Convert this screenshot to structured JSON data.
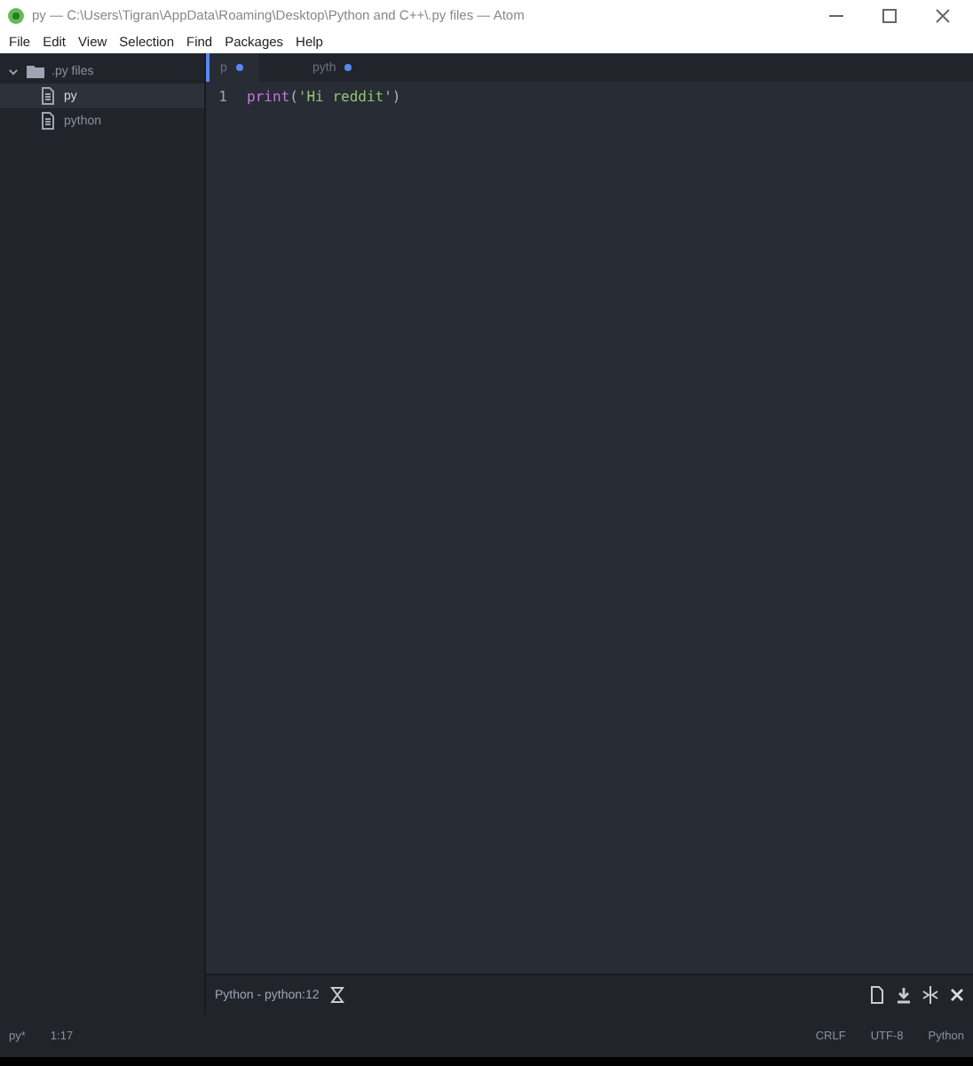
{
  "window": {
    "title": "py — C:\\Users\\Tigran\\AppData\\Roaming\\Desktop\\Python and C++\\.py files — Atom"
  },
  "menu": [
    "File",
    "Edit",
    "View",
    "Selection",
    "Find",
    "Packages",
    "Help"
  ],
  "tree": {
    "label": ".py files",
    "expanded": true,
    "children": [
      {
        "label": "py",
        "selected": true
      },
      {
        "label": "python",
        "selected": false
      }
    ]
  },
  "tabs": [
    {
      "label": "p",
      "selected": true,
      "modified": true
    },
    {
      "label": "pyth",
      "selected": false,
      "modified": true
    }
  ],
  "editor": {
    "lines": [
      {
        "number": "1",
        "keyword": "print",
        "rest": "(",
        "string": "'Hi reddit'",
        "end": ")"
      }
    ]
  },
  "panel": {
    "label": "Python - python:12"
  },
  "status": {
    "file": "py*",
    "cursor": "1:17",
    "right": [
      "CRLF",
      "UTF-8",
      "Python"
    ]
  }
}
